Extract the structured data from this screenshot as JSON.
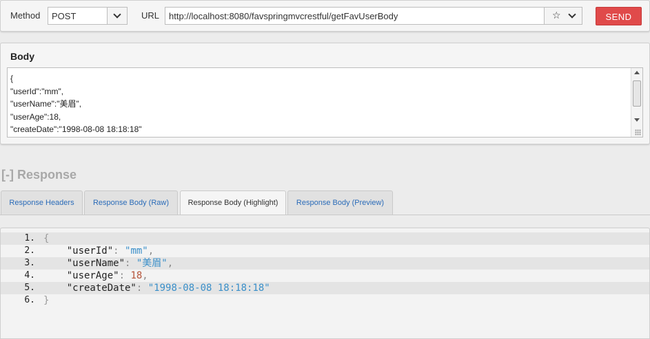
{
  "request": {
    "method_label": "Method",
    "method_value": "POST",
    "url_label": "URL",
    "url_value": "http://localhost:8080/favspringmvcrestful/getFavUserBody",
    "send_label": "SEND"
  },
  "body": {
    "title": "Body",
    "lines": [
      "{",
      "\"userId\":\"mm\",",
      "\"userName\":\"美眉\",",
      "\"userAge\":18,",
      "\"createDate\":\"1998-08-08 18:18:18\""
    ]
  },
  "response": {
    "title": "[-] Response",
    "tabs": [
      {
        "label": "Response Headers",
        "active": false
      },
      {
        "label": "Response Body (Raw)",
        "active": false
      },
      {
        "label": "Response Body (Highlight)",
        "active": true
      },
      {
        "label": "Response Body (Preview)",
        "active": false
      }
    ],
    "line_numbers": [
      "1.",
      "2.",
      "3.",
      "4.",
      "5.",
      "6."
    ],
    "code": {
      "open": "{",
      "close": "}",
      "indent": "    ",
      "fields": [
        {
          "key": "\"userId\"",
          "value": "\"mm\"",
          "type": "string",
          "trail": ","
        },
        {
          "key": "\"userName\"",
          "value": "\"美眉\"",
          "type": "string",
          "trail": ","
        },
        {
          "key": "\"userAge\"",
          "value": "18",
          "type": "number",
          "trail": ","
        },
        {
          "key": "\"createDate\"",
          "value": "\"1998-08-08 18:18:18\"",
          "type": "string",
          "trail": ""
        }
      ]
    }
  },
  "colors": {
    "send_button": "#e04a4a",
    "tab_link": "#2a6bb8",
    "json_string": "#3a8fc9",
    "json_number": "#b5543a"
  }
}
